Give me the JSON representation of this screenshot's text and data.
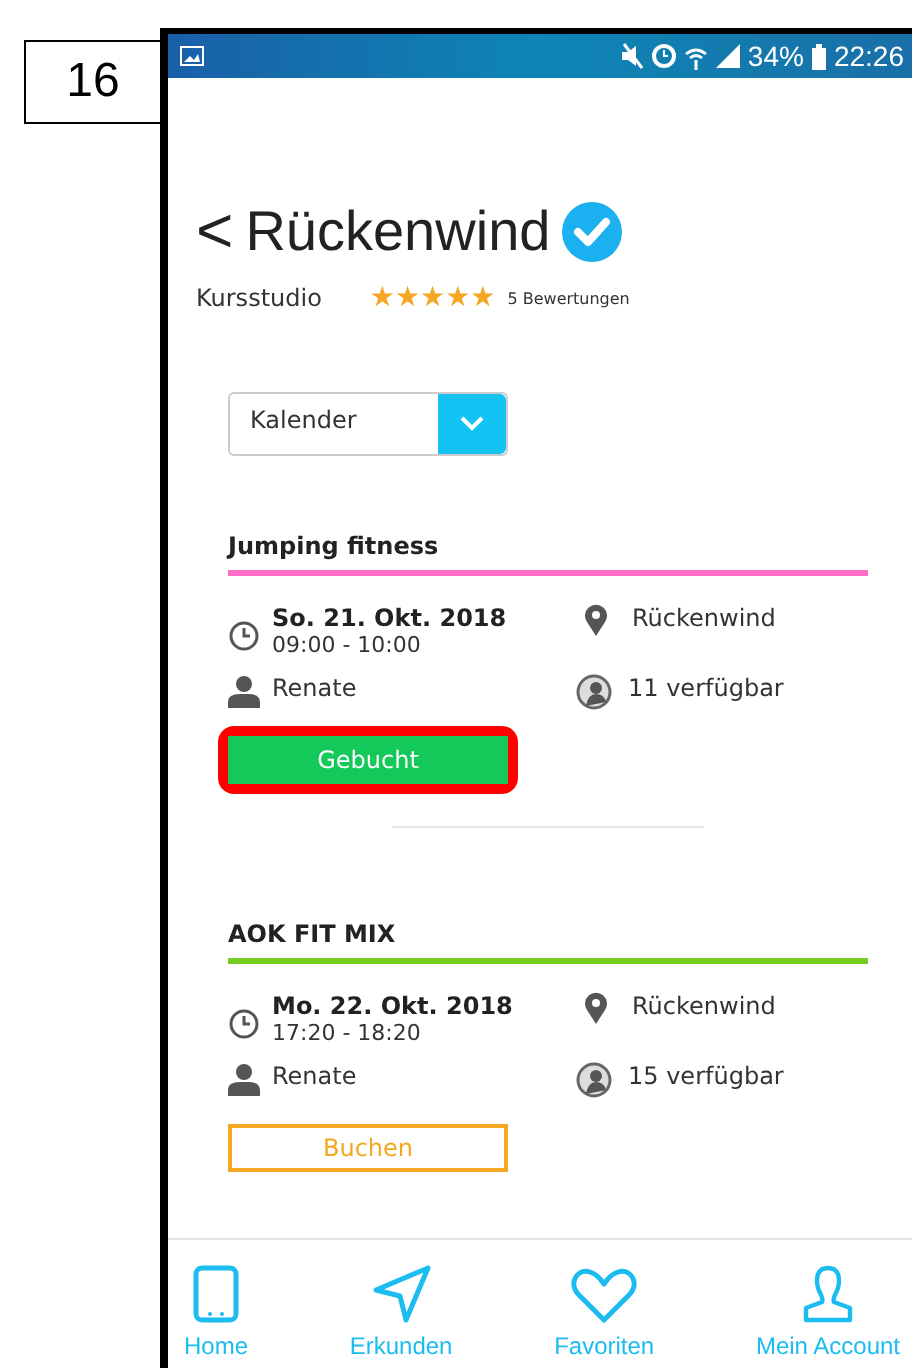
{
  "figure_label": "16",
  "status_bar": {
    "battery": "34%",
    "time": "22:26"
  },
  "header": {
    "back": "<",
    "title": "Rückenwind",
    "verified": true,
    "category": "Kursstudio",
    "stars": 5,
    "reviews": "5 Bewertungen"
  },
  "view_select": {
    "value": "Kalender"
  },
  "courses": [
    {
      "title": "Jumping fitness",
      "color": "#ff6ec7",
      "date": "So. 21. Okt. 2018",
      "time": "09:00 - 10:00",
      "location": "Rückenwind",
      "trainer": "Renate",
      "availability": "11 verfügbar",
      "button": {
        "label": "Gebucht",
        "kind": "booked"
      },
      "highlighted": true
    },
    {
      "title": "AOK FIT MIX",
      "color": "#77cc22",
      "date": "Mo. 22. Okt. 2018",
      "time": "17:20 - 18:20",
      "location": "Rückenwind",
      "trainer": "Renate",
      "availability": "15 verfügbar",
      "button": {
        "label": "Buchen",
        "kind": "book"
      },
      "highlighted": false
    }
  ],
  "nav": [
    {
      "label": "Home",
      "kind": "tablet"
    },
    {
      "label": "Erkunden",
      "kind": "explore"
    },
    {
      "label": "Favoriten",
      "kind": "heart"
    },
    {
      "label": "Mein Account",
      "kind": "account"
    }
  ]
}
